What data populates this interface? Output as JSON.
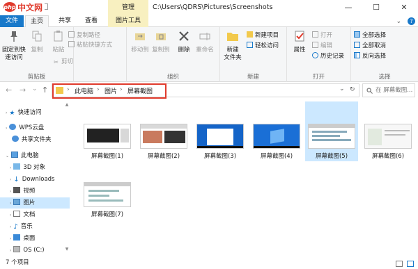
{
  "logo": {
    "mark": "php",
    "text": "中文网"
  },
  "title": {
    "context_tab": "管理",
    "path": "C:\\Users\\QDRS\\Pictures\\Screenshots",
    "minimize": "—",
    "maximize": "☐",
    "close": "✕"
  },
  "tabs": [
    {
      "label": "文件"
    },
    {
      "label": "主页"
    },
    {
      "label": "共享"
    },
    {
      "label": "查看"
    },
    {
      "label": "图片工具"
    }
  ],
  "ribbon": {
    "clipboard": {
      "label": "剪贴板",
      "pin": "固定到快\n速访问",
      "copy": "复制",
      "paste": "粘贴",
      "copy_path": "复制路径",
      "paste_shortcut": "粘贴快捷方式",
      "cut": "剪切"
    },
    "organize": {
      "label": "组织",
      "move_to": "移动到",
      "copy_to": "复制到",
      "delete": "删除",
      "rename": "重命名"
    },
    "new": {
      "label": "新建",
      "new_folder": "新建\n文件夹",
      "new_item": "新建项目",
      "easy_access": "轻松访问"
    },
    "open": {
      "label": "打开",
      "properties": "属性",
      "open": "打开",
      "edit": "编辑",
      "history": "历史记录"
    },
    "select": {
      "label": "选择",
      "select_all": "全部选择",
      "select_none": "全部取消",
      "invert": "反向选择"
    }
  },
  "address": {
    "back": "←",
    "forward": "→",
    "dropdown": "⌄",
    "up": "↑",
    "crumbs": [
      "此电脑",
      "图片",
      "屏幕截图"
    ],
    "sep": "›",
    "chev": "⌄",
    "refresh": "↻",
    "search_placeholder": "在 屏幕截图..."
  },
  "nav": {
    "items": [
      {
        "label": "快速访问"
      },
      {
        "label": "WPS云盘"
      },
      {
        "label": "共享文件夹"
      },
      {
        "label": "此电脑"
      },
      {
        "label": "3D 对象"
      },
      {
        "label": "Downloads"
      },
      {
        "label": "视频"
      },
      {
        "label": "图片"
      },
      {
        "label": "文档"
      },
      {
        "label": "音乐"
      },
      {
        "label": "桌面"
      },
      {
        "label": "OS (C:)"
      }
    ]
  },
  "files": [
    {
      "name": "屏幕截图(1)"
    },
    {
      "name": "屏幕截图(2)"
    },
    {
      "name": "屏幕截图(3)"
    },
    {
      "name": "屏幕截图(4)"
    },
    {
      "name": "屏幕截图(5)"
    },
    {
      "name": "屏幕截图(6)"
    },
    {
      "name": "屏幕截图(7)"
    }
  ],
  "status": {
    "count": "7 个项目"
  },
  "colors": {
    "accent": "#1979ca",
    "highlight": "#e03a2c",
    "selection": "#cce8ff",
    "context": "#f8f0c0"
  }
}
